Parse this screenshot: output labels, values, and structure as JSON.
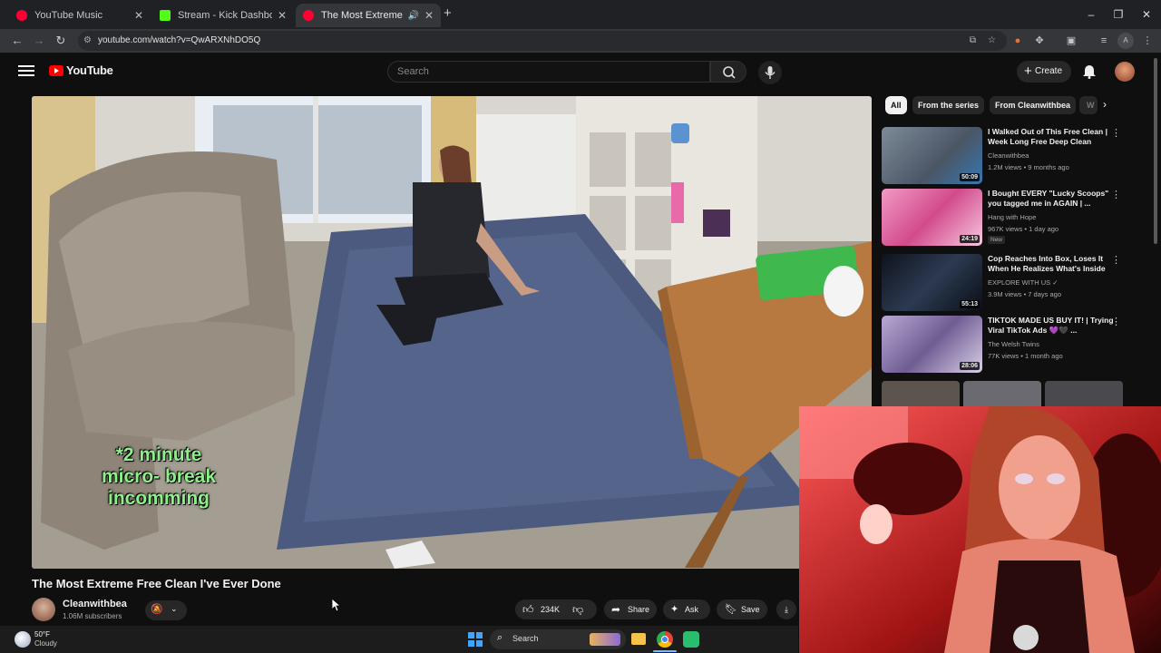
{
  "browser": {
    "tabs": [
      {
        "title": "YouTube Music",
        "favicon_color": "#ff0033",
        "active": false
      },
      {
        "title": "Stream - Kick Dashboard",
        "favicon_color": "#53fc18",
        "active": false
      },
      {
        "title": "The Most Extreme Free Clea",
        "favicon_color": "#ff0033",
        "active": true
      }
    ],
    "url": "youtube.com/watch?v=QwARXNhDO5Q",
    "window_controls": {
      "minimize": "–",
      "maximize": "❐",
      "close": "✕"
    },
    "profile_initial": "A"
  },
  "youtube": {
    "logo_text": "YouTube",
    "search_placeholder": "Search",
    "create_label": "Create"
  },
  "video": {
    "caption_line1": "*2 minute",
    "caption_line2": "micro- break",
    "caption_line3": "incomming",
    "title": "The Most Extreme Free Clean I've Ever Done",
    "channel": "Cleanwithbea",
    "subscribers": "1.06M subscribers",
    "likes": "234K",
    "share_label": "Share",
    "ask_label": "Ask",
    "save_label": "Save"
  },
  "chips": [
    "All",
    "From the series",
    "From Cleanwithbea",
    "W"
  ],
  "recommendations": [
    {
      "title": "I Walked Out of This Free Clean | Week Long Free Deep Clean",
      "channel": "Cleanwithbea",
      "meta": "1.2M views • 9 months ago",
      "duration": "50:09",
      "badge": "",
      "thumb_color": "#5f6d7e"
    },
    {
      "title": "I Bought EVERY \"Lucky Scoops\" you tagged me in AGAIN | ...",
      "channel": "Hang with Hope",
      "meta": "967K views • 1 day ago",
      "duration": "24:19",
      "badge": "New",
      "thumb_color": "#e86aa8"
    },
    {
      "title": "Cop Reaches Into Box, Loses It When He Realizes What's Inside",
      "channel": "EXPLORE WITH US ✓",
      "meta": "3.9M views • 7 days ago",
      "duration": "55:13",
      "badge": "",
      "thumb_color": "#1b2331"
    },
    {
      "title": "TIKTOK MADE US BUY IT! | Trying Viral TikTok Ads 💜🖤 ...",
      "channel": "The Welsh Twins",
      "meta": "77K views • 1 month ago",
      "duration": "28:06",
      "badge": "",
      "thumb_color": "#8b7fb0"
    }
  ],
  "taskbar": {
    "weather_temp": "50°F",
    "weather_desc": "Cloudy",
    "search_label": "Search"
  }
}
